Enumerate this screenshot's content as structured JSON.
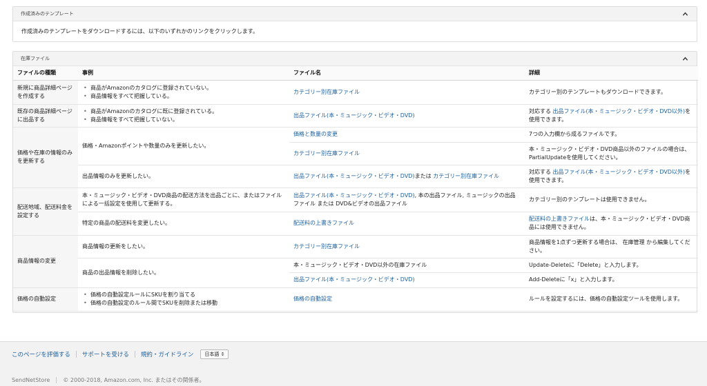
{
  "templates_panel": {
    "title": "作成済みのテンプレート",
    "description": "作成済みのテンプレートをダウンロードするには、以下のいずれかのリンクをクリックします。"
  },
  "inventory_panel": {
    "title": "在庫ファイル",
    "headers": {
      "type": "ファイルの種類",
      "example": "事例",
      "filename": "ファイル名",
      "details": "詳細"
    },
    "new_listing": {
      "type": "新規に商品詳細ページを作成する",
      "bullets": [
        "商品がAmazonのカタログに登録されていない。",
        "商品情報をすべて把握している。"
      ],
      "file": "カテゴリー別在庫ファイル",
      "detail": "カテゴリー別のテンプレートもダウンロードできます。"
    },
    "existing_listing": {
      "type": "既存の商品詳細ページに出品する",
      "bullets": [
        "商品がAmazonのカタログに既に登録されている。",
        "商品情報をすべて把握していない。"
      ],
      "file": "出品ファイル(本・ミュージック・ビデオ・DVD)",
      "detail_pre": "対応する ",
      "detail_link": "出品ファイル(本・ミュージック・ビデオ・DVD以外)",
      "detail_post": "を使用できます。"
    },
    "price_qty": {
      "type": "価格や在庫の情報のみを更新する",
      "example1": "価格・Amazonポイントや数量のみを更新したい。",
      "file1": "価格と数量の変更",
      "detail1": "7つの入力欄から成るファイルです。",
      "file2": "カテゴリー別在庫ファイル",
      "detail2": "本・ミュージック・ビデオ・DVD商品以外のファイルの場合は、PartialUpdateを使用してください。",
      "example2": "出品情報のみを更新したい。",
      "file3_link1": "出品ファイル(本・ミュージック・ビデオ・DVD)",
      "file3_mid": "または ",
      "file3_link2": "カテゴリー別在庫ファイル",
      "detail3_pre": "対応する ",
      "detail3_link": "出品ファイル(本・ミュージック・ビデオ・DVD以外)",
      "detail3_post": "を使用できます。"
    },
    "shipping": {
      "type": "配送地域、配送料金を設定する",
      "example1": "本・ミュージック・ビデオ・DVD商品の配送方法を出品ごとに、またはファイルによる一括設定を使用して更新する。",
      "file1_link": "出品ファイル(本・ミュージック・ビデオ・DVD)",
      "file1_rest": ", 本の出品ファイル, ミュージックの出品ファイル または DVD&ビデオの出品ファイル",
      "detail1": "カテゴリー別のテンプレートは使用できません。",
      "example2": "特定の商品の配送料を変更したい。",
      "file2": "配送料の上書きファイル",
      "detail2_link": "配送料の上書きファイル",
      "detail2_post": "は、本・ミュージック・ビデオ・DVD商品には使用できません。"
    },
    "modify": {
      "type": "商品情報の変更",
      "example1": "商品情報の更新をしたい。",
      "file1": "カテゴリー別在庫ファイル",
      "detail1": "商品情報を1点ずつ更新する場合は、 在庫管理 から編集してください。",
      "example2": "商品の出品情報を削除したい。",
      "file2": "本・ミュージック・ビデオ・DVD以外の在庫ファイル",
      "detail2": "Update-Deleteに「Delete」と入力します。",
      "file3": "出品ファイル(本・ミュージック・ビデオ・DVD)",
      "detail3": "Add-Deleteに「x」と入力します。"
    },
    "auto_pricing": {
      "type": "価格の自動設定",
      "bullets": [
        "価格の自動設定ルールにSKUを割り当てる",
        "価格の自動設定のルール間でSKUを削除または移動"
      ],
      "file": "価格の自動設定",
      "detail": "ルールを設定するには、価格の自動設定ツールを使用します。"
    }
  },
  "footer": {
    "rate": "このページを評価する",
    "support": "サポートを受ける",
    "policy": "規約・ガイドライン",
    "language": "日本語",
    "store": "SendNetStore",
    "copyright": "© 2000-2018, Amazon.com, Inc. またはその関係者。"
  },
  "icons": {
    "collapse": "chevron-up-icon",
    "dropdown": "updown-arrows-icon"
  },
  "colors": {
    "link": "#1a5f9e",
    "header_bg": "#f3f3f3",
    "type_cell_bg": "#f6f6f6",
    "footer_bg": "#f2f2f2"
  }
}
